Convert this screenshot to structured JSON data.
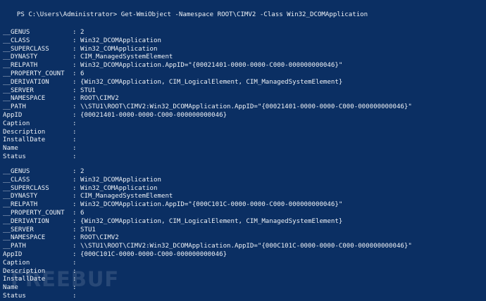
{
  "prompt": {
    "text": "PS C:\\Users\\Administrator>",
    "command": " Get-WmiObject -Namespace ROOT\\CIMV2 -Class Win32_DCOMApplication"
  },
  "objects": [
    {
      "rows": [
        {
          "label": "__GENUS",
          "sep": ":",
          "value": "2"
        },
        {
          "label": "__CLASS",
          "sep": ":",
          "value": "Win32_DCOMApplication"
        },
        {
          "label": "__SUPERCLASS",
          "sep": ":",
          "value": "Win32_COMApplication"
        },
        {
          "label": "__DYNASTY",
          "sep": ":",
          "value": "CIM_ManagedSystemElement"
        },
        {
          "label": "__RELPATH",
          "sep": ":",
          "value": "Win32_DCOMApplication.AppID=\"{00021401-0000-0000-C000-000000000046}\""
        },
        {
          "label": "__PROPERTY_COUNT",
          "sep": ":",
          "value": "6"
        },
        {
          "label": "__DERIVATION",
          "sep": ":",
          "value": "{Win32_COMApplication, CIM_LogicalElement, CIM_ManagedSystemElement}"
        },
        {
          "label": "__SERVER",
          "sep": ":",
          "value": "STU1"
        },
        {
          "label": "__NAMESPACE",
          "sep": ":",
          "value": "ROOT\\CIMV2"
        },
        {
          "label": "__PATH",
          "sep": ":",
          "value": "\\\\STU1\\ROOT\\CIMV2:Win32_DCOMApplication.AppID=\"{00021401-0000-0000-C000-000000000046}\""
        },
        {
          "label": "AppID",
          "sep": ":",
          "value": "{00021401-0000-0000-C000-000000000046}"
        },
        {
          "label": "Caption",
          "sep": ":",
          "value": ""
        },
        {
          "label": "Description",
          "sep": ":",
          "value": ""
        },
        {
          "label": "InstallDate",
          "sep": ":",
          "value": ""
        },
        {
          "label": "Name",
          "sep": ":",
          "value": ""
        },
        {
          "label": "Status",
          "sep": ":",
          "value": ""
        }
      ]
    },
    {
      "rows": [
        {
          "label": "__GENUS",
          "sep": ":",
          "value": "2"
        },
        {
          "label": "__CLASS",
          "sep": ":",
          "value": "Win32_DCOMApplication"
        },
        {
          "label": "__SUPERCLASS",
          "sep": ":",
          "value": "Win32_COMApplication"
        },
        {
          "label": "__DYNASTY",
          "sep": ":",
          "value": "CIM_ManagedSystemElement"
        },
        {
          "label": "__RELPATH",
          "sep": ":",
          "value": "Win32_DCOMApplication.AppID=\"{000C101C-0000-0000-C000-000000000046}\""
        },
        {
          "label": "__PROPERTY_COUNT",
          "sep": ":",
          "value": "6"
        },
        {
          "label": "__DERIVATION",
          "sep": ":",
          "value": "{Win32_COMApplication, CIM_LogicalElement, CIM_ManagedSystemElement}"
        },
        {
          "label": "__SERVER",
          "sep": ":",
          "value": "STU1"
        },
        {
          "label": "__NAMESPACE",
          "sep": ":",
          "value": "ROOT\\CIMV2"
        },
        {
          "label": "__PATH",
          "sep": ":",
          "value": "\\\\STU1\\ROOT\\CIMV2:Win32_DCOMApplication.AppID=\"{000C101C-0000-0000-C000-000000000046}\""
        },
        {
          "label": "AppID",
          "sep": ":",
          "value": "{000C101C-0000-0000-C000-000000000046}"
        },
        {
          "label": "Caption",
          "sep": ":",
          "value": ""
        },
        {
          "label": "Description",
          "sep": ":",
          "value": ""
        },
        {
          "label": "InstallDate",
          "sep": ":",
          "value": ""
        },
        {
          "label": "Name",
          "sep": ":",
          "value": ""
        },
        {
          "label": "Status",
          "sep": ":",
          "value": ""
        }
      ]
    }
  ],
  "watermark": "FREEBUF"
}
